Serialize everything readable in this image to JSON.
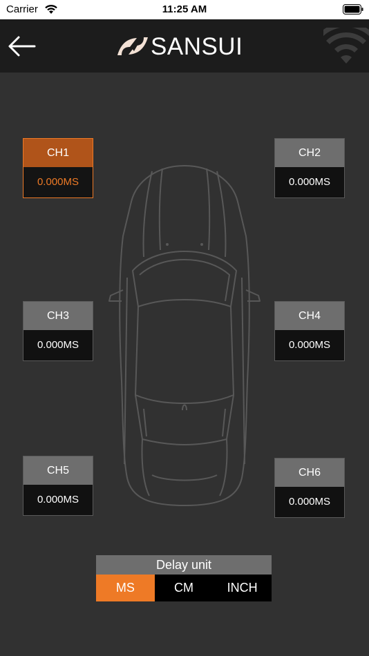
{
  "status_bar": {
    "carrier": "Carrier",
    "time": "11:25 AM"
  },
  "header": {
    "brand": "SANSUI",
    "back_icon": "arrow-left-icon",
    "wifi_icon": "wifi-icon"
  },
  "colors": {
    "accent": "#ee7a26",
    "background": "#313131",
    "header_bg": "#1c1c1c"
  },
  "channels": [
    {
      "label": "CH1",
      "value": "0.000MS",
      "selected": true
    },
    {
      "label": "CH2",
      "value": "0.000MS",
      "selected": false
    },
    {
      "label": "CH3",
      "value": "0.000MS",
      "selected": false
    },
    {
      "label": "CH4",
      "value": "0.000MS",
      "selected": false
    },
    {
      "label": "CH5",
      "value": "0.000MS",
      "selected": false
    },
    {
      "label": "CH6",
      "value": "0.000MS",
      "selected": false
    }
  ],
  "delay_unit": {
    "title": "Delay unit",
    "options": [
      "MS",
      "CM",
      "INCH"
    ],
    "selected": "MS"
  }
}
